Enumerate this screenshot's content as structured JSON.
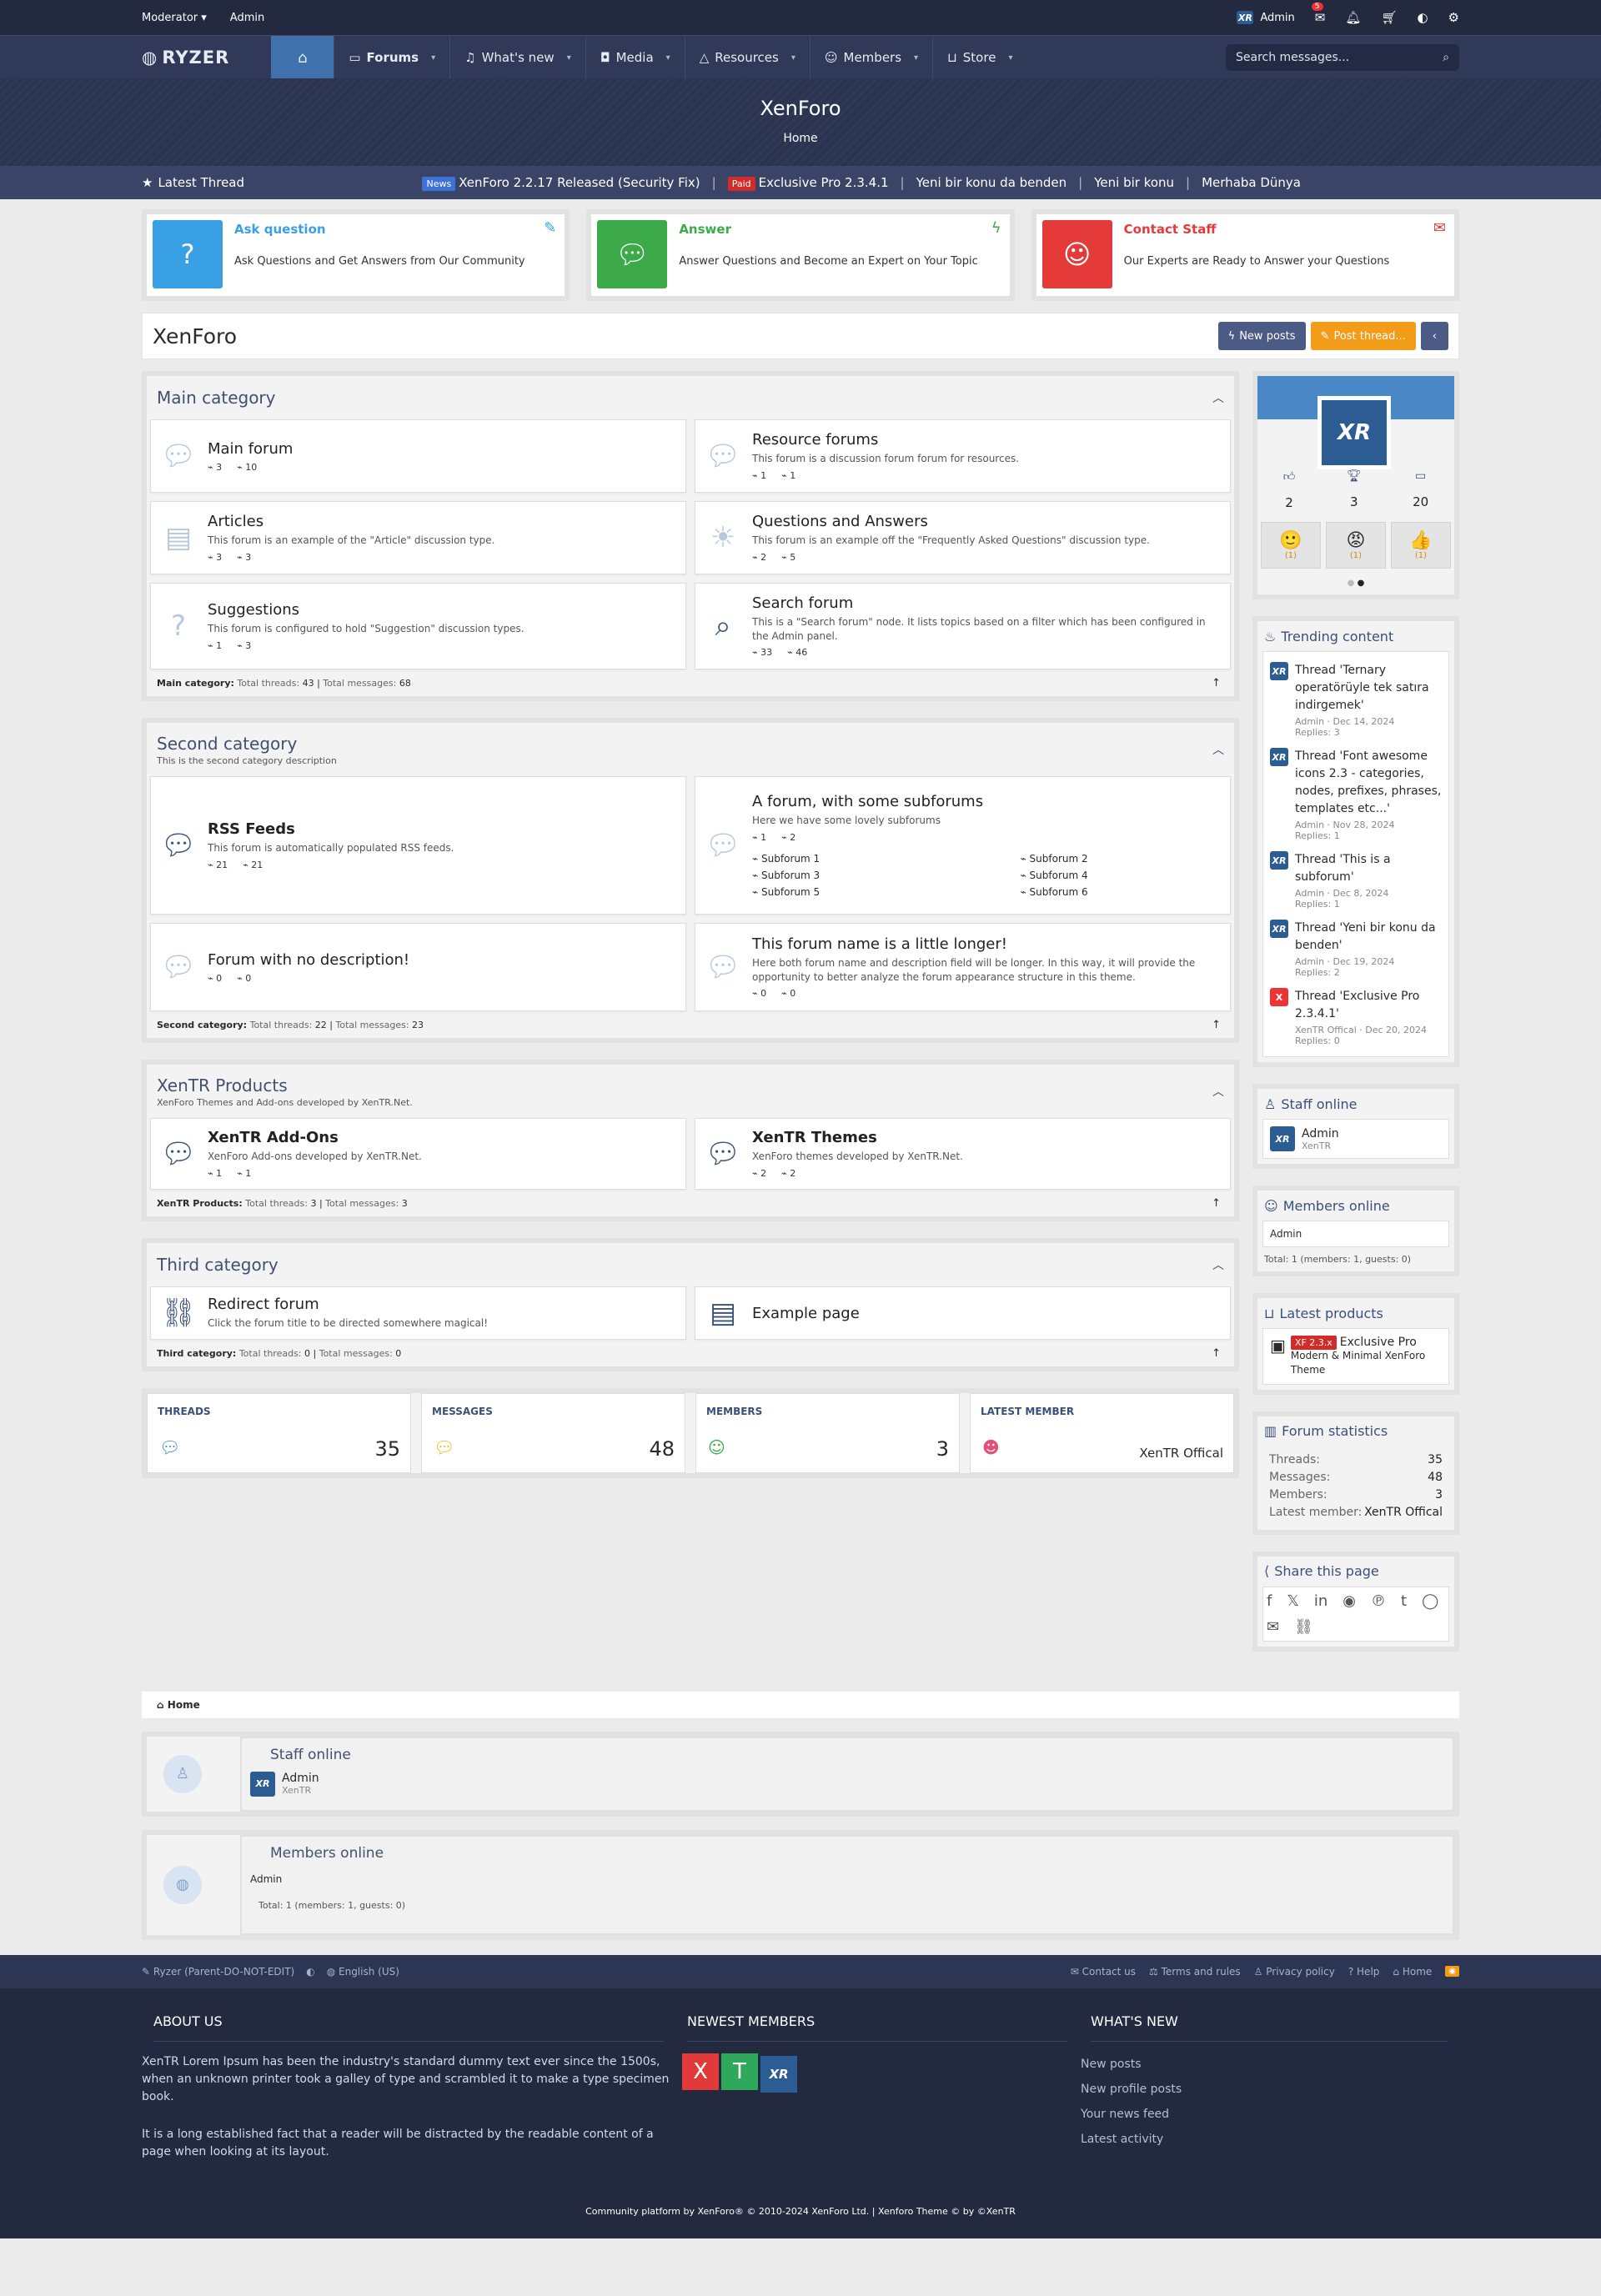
{
  "topbar": {
    "moderator": "Moderator ▾",
    "admin_link": "Admin",
    "user": "Admin",
    "badge": "5"
  },
  "nav": {
    "logo": "RYZER",
    "tabs": [
      {
        "label": "Forums"
      },
      {
        "label": "What's new"
      },
      {
        "label": "Media"
      },
      {
        "label": "Resources"
      },
      {
        "label": "Members"
      },
      {
        "label": "Store"
      }
    ],
    "search_placeholder": "Search messages..."
  },
  "hero": {
    "title": "XenForo",
    "crumb": "Home"
  },
  "ticker": {
    "label": "Latest Thread",
    "tag1": "News",
    "item1": "XenForo 2.2.17 Released (Security Fix)",
    "tag2": "Paid",
    "item2": "Exclusive Pro 2.3.4.1",
    "item3": "Yeni bir konu da benden",
    "item4": "Yeni bir konu",
    "item5": "Merhaba Dünya"
  },
  "promos": [
    {
      "title": "Ask question",
      "desc": "Ask Questions and Get Answers from Our Community",
      "color": "#3aa0e6"
    },
    {
      "title": "Answer",
      "desc": "Answer Questions and Become an Expert on Your Topic",
      "color": "#3daa4a"
    },
    {
      "title": "Contact Staff",
      "desc": "Our Experts are Ready to Answer your Questions",
      "color": "#e43a3a"
    }
  ],
  "page": {
    "title": "XenForo",
    "new_posts": "New posts",
    "post_thread": "Post thread...",
    "back": "‹"
  },
  "cats": {
    "c1": {
      "name": "Main category",
      "foot_label": "Main category:",
      "threads": "43",
      "messages": "68",
      "nodes": [
        {
          "title": "Main forum",
          "desc": "",
          "t": "3",
          "m": "10"
        },
        {
          "title": "Resource forums",
          "desc": "This forum is a discussion forum forum for resources.",
          "t": "1",
          "m": "1"
        },
        {
          "title": "Articles",
          "desc": "This forum is an example of the \"Article\" discussion type.",
          "t": "3",
          "m": "3"
        },
        {
          "title": "Questions and Answers",
          "desc": "This forum is an example off the \"Frequently Asked Questions\" discussion type.",
          "t": "2",
          "m": "5"
        },
        {
          "title": "Suggestions",
          "desc": "This forum is configured to hold \"Suggestion\" discussion types.",
          "t": "1",
          "m": "3"
        },
        {
          "title": "Search forum",
          "desc": "This is a \"Search forum\" node. It lists topics based on a filter which has been configured in the Admin panel.",
          "t": "33",
          "m": "46"
        }
      ]
    },
    "c2": {
      "name": "Second category",
      "desc": "This is the second category description",
      "foot_label": "Second category:",
      "threads": "22",
      "messages": "23",
      "nodes": [
        {
          "title": "RSS Feeds",
          "desc": "This forum is automatically populated RSS feeds.",
          "t": "21",
          "m": "21"
        },
        {
          "title": "A forum, with some subforums",
          "desc": "Here we have some lovely subforums",
          "t": "1",
          "m": "2",
          "subs": [
            "Subforum 1",
            "Subforum 2",
            "Subforum 3",
            "Subforum 4",
            "Subforum 5",
            "Subforum 6"
          ]
        },
        {
          "title": "Forum with no description!",
          "desc": "",
          "t": "0",
          "m": "0"
        },
        {
          "title": "This forum name is a little longer!",
          "desc": "Here both forum name and description field will be longer. In this way, it will provide the opportunity to better analyze the forum appearance structure in this theme.",
          "t": "0",
          "m": "0"
        }
      ]
    },
    "c3": {
      "name": "XenTR Products",
      "desc": "XenForo Themes and Add-ons developed by XenTR.Net.",
      "foot_label": "XenTR Products:",
      "threads": "3",
      "messages": "3",
      "nodes": [
        {
          "title": "XenTR Add-Ons",
          "desc": "XenForo Add-ons developed by XenTR.Net.",
          "t": "1",
          "m": "1"
        },
        {
          "title": "XenTR Themes",
          "desc": "XenForo themes developed by XenTR.Net.",
          "t": "2",
          "m": "2"
        }
      ]
    },
    "c4": {
      "name": "Third category",
      "foot_label": "Third category:",
      "threads": "0",
      "messages": "0",
      "nodes": [
        {
          "title": "Redirect forum",
          "desc": "Click the forum title to be directed somewhere magical!"
        },
        {
          "title": "Example page",
          "desc": ""
        }
      ]
    }
  },
  "labels": {
    "total_threads": "Total threads:",
    "total_messages": "Total messages:"
  },
  "stats": {
    "threads_l": "THREADS",
    "threads": "35",
    "messages_l": "MESSAGES",
    "messages": "48",
    "members_l": "MEMBERS",
    "members": "3",
    "latest_l": "LATEST MEMBER",
    "latest": "XenTR Offical"
  },
  "profile": {
    "av": "XR",
    "a": "2",
    "b": "3",
    "c": "20",
    "r1": "(1)",
    "r2": "(1)",
    "r3": "(1)"
  },
  "trending": {
    "title": "Trending content",
    "items": [
      {
        "t": "Thread 'Ternary operatörüyle tek satıra indirgemek'",
        "m": "Admin · Dec 14, 2024",
        "r": "Replies: 3"
      },
      {
        "t": "Thread 'Font awesome icons 2.3 - categories, nodes, prefixes, phrases, templates etc...'",
        "m": "Admin · Nov 28, 2024",
        "r": "Replies: 1"
      },
      {
        "t": "Thread 'This is a subforum'",
        "m": "Admin · Dec 8, 2024",
        "r": "Replies: 1"
      },
      {
        "t": "Thread 'Yeni bir konu da benden'",
        "m": "Admin · Dec 19, 2024",
        "r": "Replies: 2"
      },
      {
        "t": "Thread 'Exclusive Pro 2.3.4.1'",
        "m": "XenTR Offical · Dec 20, 2024",
        "r": "Replies: 0"
      }
    ]
  },
  "staff": {
    "title": "Staff online",
    "name": "Admin",
    "role": "XenTR"
  },
  "members_online": {
    "title": "Members online",
    "name": "Admin",
    "total": "Total: 1 (members: 1, guests: 0)"
  },
  "products": {
    "title": "Latest products",
    "tag": "XF 2.3.x",
    "name": "Exclusive Pro",
    "desc": "Modern & Minimal XenForo Theme"
  },
  "forum_stats": {
    "title": "Forum statistics",
    "threads_l": "Threads:",
    "threads": "35",
    "messages_l": "Messages:",
    "messages": "48",
    "members_l": "Members:",
    "members": "3",
    "latest_l": "Latest member:",
    "latest": "XenTR Offical"
  },
  "share": {
    "title": "Share this page"
  },
  "bottom": {
    "crumb": "Home",
    "staff_title": "Staff online",
    "staff_name": "Admin",
    "staff_role": "XenTR",
    "members_title": "Members online",
    "members_name": "Admin",
    "members_total": "Total: 1 (members: 1, guests: 0)"
  },
  "footbar": {
    "style": "Ryzer (Parent-DO-NOT-EDIT)",
    "lang": "English (US)",
    "contact": "Contact us",
    "terms": "Terms and rules",
    "privacy": "Privacy policy",
    "help": "Help",
    "home": "Home"
  },
  "footer": {
    "about_t": "ABOUT US",
    "about_p1": "XenTR Lorem Ipsum has been the industry's standard dummy text ever since the 1500s, when an unknown printer took a galley of type and scrambled it to make a type specimen book.",
    "about_p2": "It is a long established fact that a reader will be distracted by the readable content of a page when looking at its layout.",
    "newest_t": "NEWEST MEMBERS",
    "whats_t": "WHAT'S NEW",
    "links": [
      "New posts",
      "New profile posts",
      "Your news feed",
      "Latest activity"
    ],
    "copy": "Community platform by XenForo® © 2010-2024 XenForo Ltd. | Xenforo Theme © by ©XenTR"
  }
}
